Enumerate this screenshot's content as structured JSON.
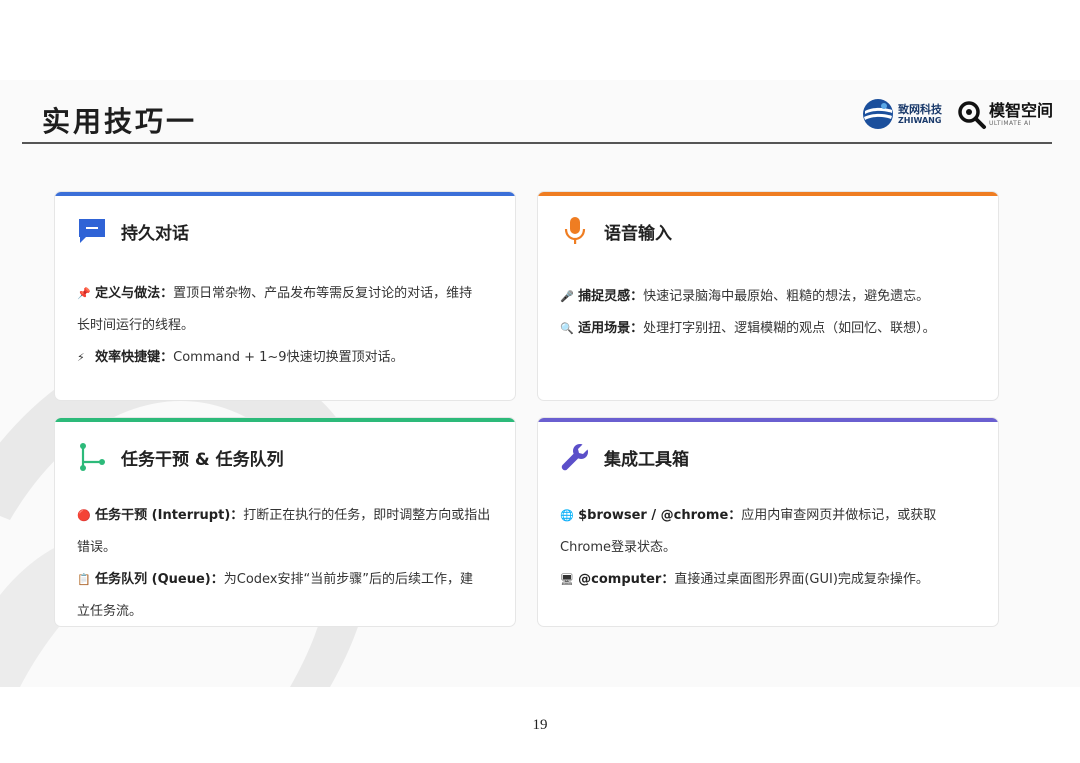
{
  "title": "实用技巧一",
  "logos": {
    "zhiwang_cn": "致网科技",
    "zhiwang_en": "ZHIWANG",
    "mozhi_cn": "模智空间",
    "mozhi_en": "ULTIMATE AI"
  },
  "colors": {
    "blue": "#3b6fd8",
    "orange": "#ef7d22",
    "green": "#2dba7a",
    "purple": "#6a5fd0"
  },
  "cards": [
    {
      "title": "持久对话",
      "icon": "chat-bubble-icon",
      "items": [
        {
          "emoji": "📌",
          "label": "定义与做法：",
          "line1": "置顶日常杂物、产品发布等需反复讨论的对话，维持",
          "line2": "长时间运行的线程。"
        },
        {
          "emoji": "⚡",
          "label": "效率快捷键：",
          "line1": "Command + 1~9快速切换置顶对话。"
        }
      ]
    },
    {
      "title": "语音输入",
      "icon": "microphone-icon",
      "items": [
        {
          "emoji": "🎤",
          "label": "捕捉灵感：",
          "line1": "快速记录脑海中最原始、粗糙的想法，避免遗忘。"
        },
        {
          "emoji": "🔍",
          "label": "适用场景：",
          "line1": "处理打字别扭、逻辑模糊的观点（如回忆、联想）。"
        }
      ]
    },
    {
      "title": "任务干预 & 任务队列",
      "icon": "branch-icon",
      "items": [
        {
          "emoji": "🔴",
          "label": "任务干预 (Interrupt)：",
          "line1": "打断正在执行的任务，即时调整方向或指出",
          "line2": "错误。"
        },
        {
          "emoji": "📋",
          "label": "任务队列 (Queue)：",
          "line1": "为Codex安排“当前步骤”后的后续工作，建",
          "line2": "立任务流。"
        }
      ]
    },
    {
      "title": "集成工具箱",
      "icon": "wrench-icon",
      "items": [
        {
          "emoji": "🌐",
          "label": "$browser / @chrome：",
          "line1": "应用内审查网页并做标记，或获取",
          "line2": "Chrome登录状态。"
        },
        {
          "emoji": "🖥",
          "label": "@computer：",
          "line1": "直接通过桌面图形界面(GUI)完成复杂操作。"
        }
      ]
    }
  ],
  "page_number": "19"
}
